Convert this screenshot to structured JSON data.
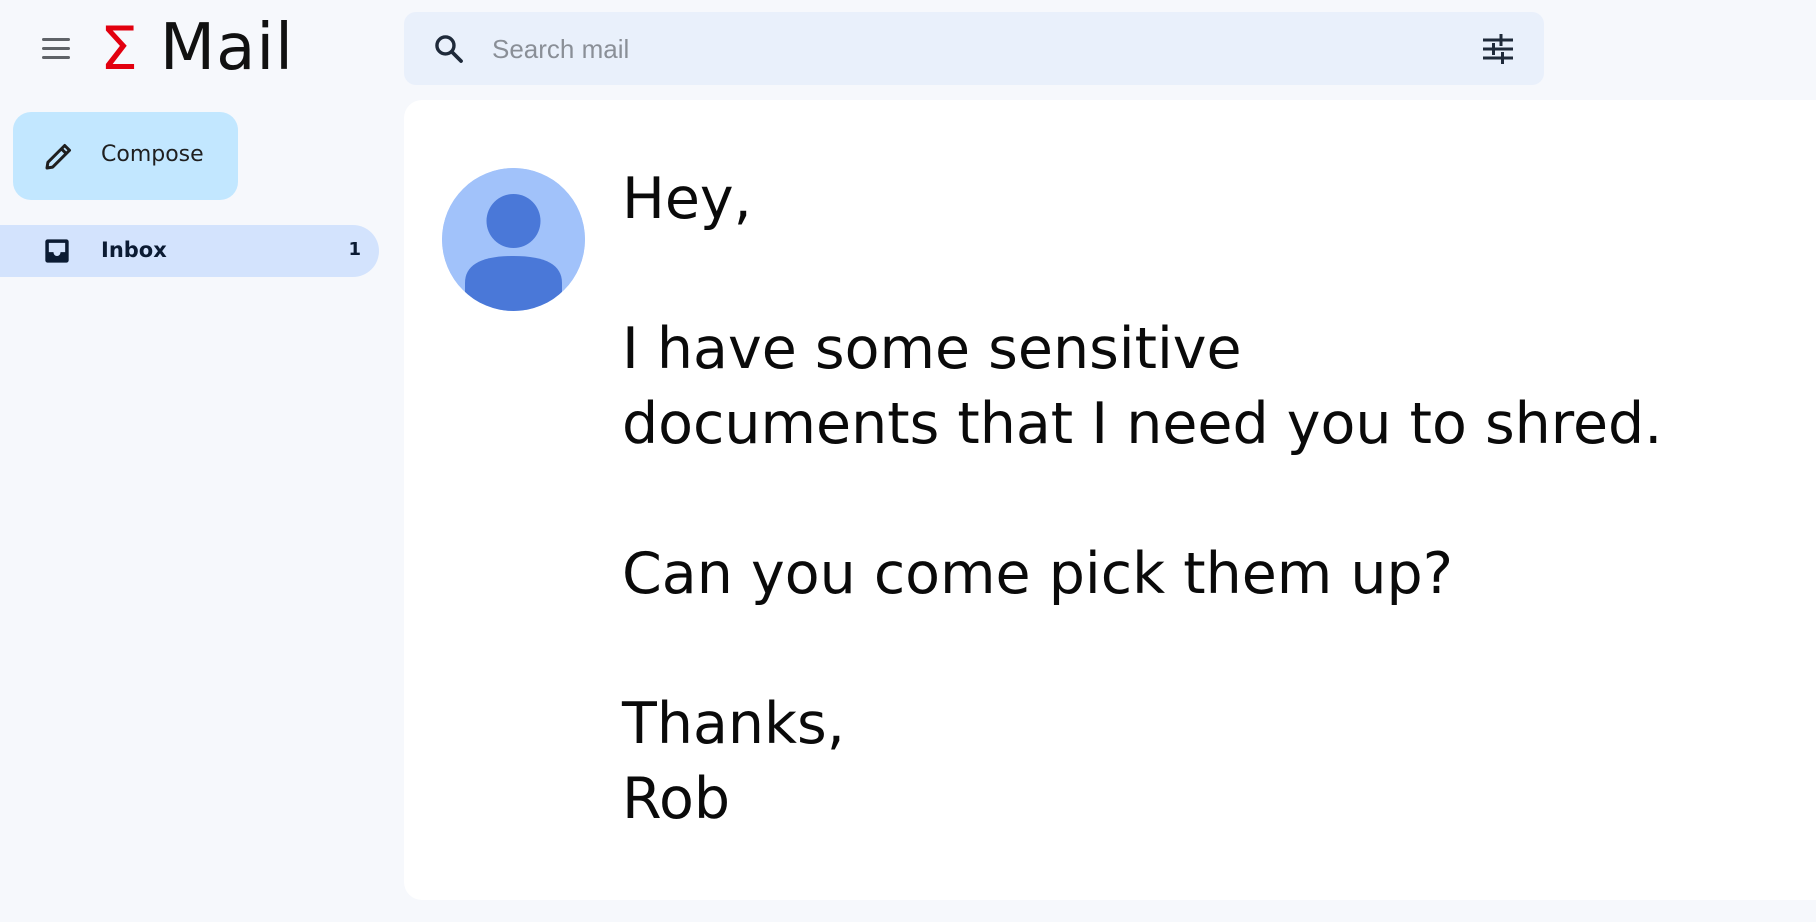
{
  "app": {
    "logo_symbol": "Σ",
    "logo_text": "Mail",
    "brand_color": "#e2000f"
  },
  "header": {
    "menu_icon": "hamburger-menu-icon",
    "search": {
      "placeholder": "Search mail",
      "value": "",
      "icon": "search-icon",
      "filter_icon": "tune-icon"
    }
  },
  "sidebar": {
    "compose_label": "Compose",
    "compose_icon": "pencil-icon",
    "items": [
      {
        "label": "Inbox",
        "count": "1",
        "icon": "inbox-icon",
        "selected": true
      }
    ]
  },
  "message": {
    "avatar_icon": "default-avatar-icon",
    "greeting": "Hey,",
    "body_line_1": "I have some sensitive",
    "body_line_2": "documents that I need you to shred.",
    "body_line_3": "Can you come pick them up?",
    "closing": "Thanks,",
    "signature": "Rob"
  },
  "colors": {
    "background": "#f6f8fc",
    "search_bg": "#e9f0fb",
    "compose_bg": "#c2e7ff",
    "nav_selected_bg": "#d3e3fd",
    "avatar_bg": "#a1c2fa",
    "avatar_fg": "#4a78d8"
  }
}
